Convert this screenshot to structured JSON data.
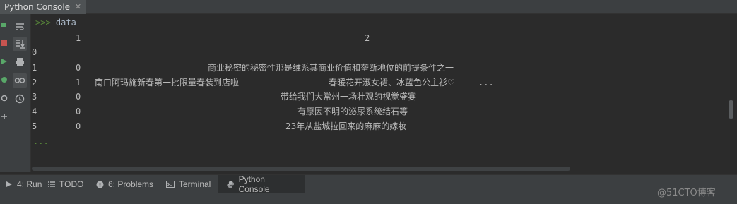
{
  "window": {
    "tab_title": "Python Console"
  },
  "toolbar": {
    "icons": [
      "soft-wrap-icon",
      "scroll-to-end-icon",
      "print-icon",
      "show-variables-icon",
      "history-icon"
    ]
  },
  "console": {
    "prompt": ">>>",
    "command": "data",
    "header_col1": "1",
    "header_col2": "2",
    "index_header": "0",
    "rows": [
      {
        "index": "1",
        "col1": "0",
        "text": "商业秘密的秘密性那是维系其商业价值和垄断地位的前提条件之一"
      },
      {
        "index": "2",
        "col1": "1",
        "text_a": "南口阿玛施新春第一批限量春装到店啦",
        "text_b": "春暖花开淑女裙、冰蓝色公主衫♡",
        "ellipsis": "..."
      },
      {
        "index": "3",
        "col1": "0",
        "text": "带给我们大常州一场壮观的视觉盛宴"
      },
      {
        "index": "4",
        "col1": "0",
        "text": "有原因不明的泌尿系统结石等"
      },
      {
        "index": "5",
        "col1": "0",
        "text": "23年从盐城拉回来的麻麻的嫁妆"
      }
    ],
    "continuation": "..."
  },
  "bottom_tabs": [
    {
      "key": "4",
      "label": ": Run"
    },
    {
      "label": "TODO"
    },
    {
      "key": "6",
      "label": ": Problems"
    },
    {
      "label": "Terminal"
    },
    {
      "label": "Python Console"
    }
  ],
  "watermark": "@51CTO博客"
}
